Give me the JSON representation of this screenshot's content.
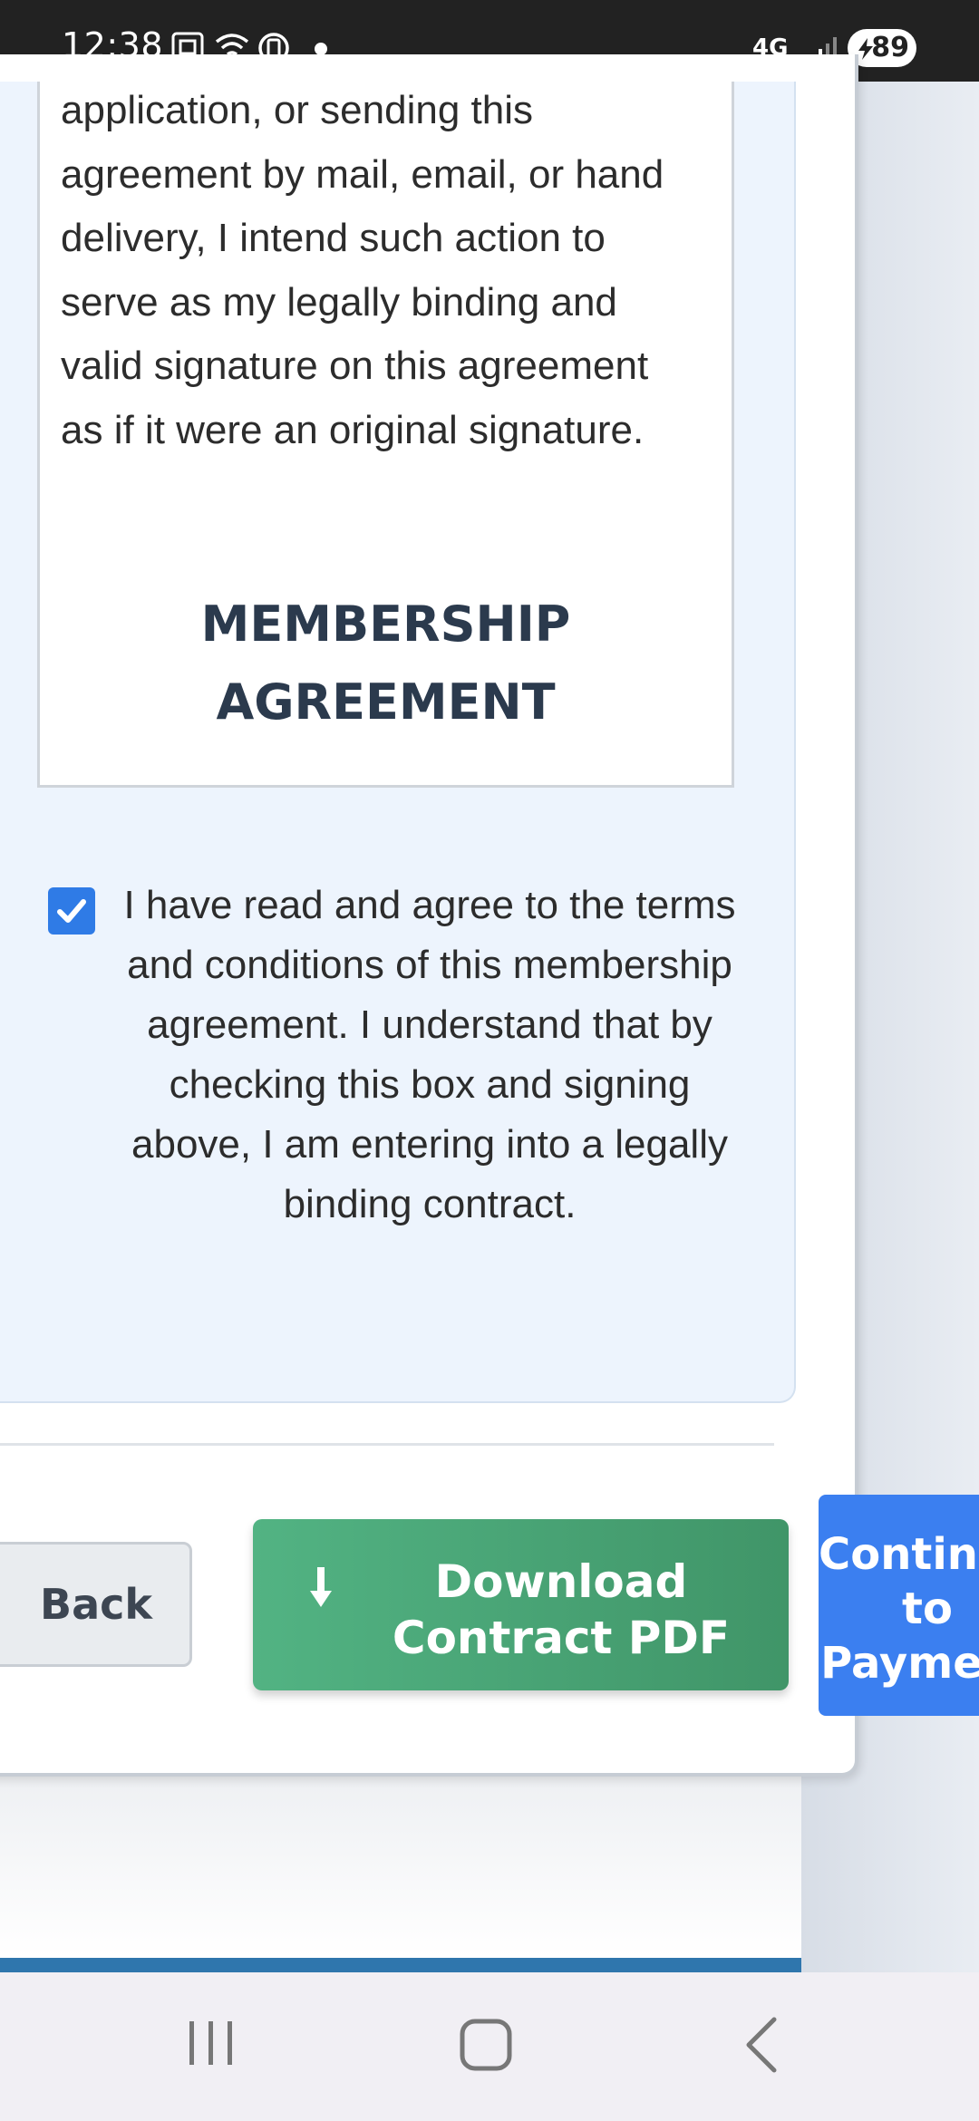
{
  "status_bar": {
    "time": "12:38",
    "network": "4G",
    "battery": "89",
    "icons": [
      "screenshot-icon",
      "wifi-icon",
      "data-saver-icon",
      "notification-dot-icon",
      "signal-icon",
      "battery-icon"
    ]
  },
  "terms": {
    "body_text": "application, or sending this agreement by mail, email, or hand delivery, I intend such action to serve as my legally binding and valid signature on this agreement as if it were an original signature.",
    "heading": "MEMBERSHIP AGREEMENT"
  },
  "agreement": {
    "checked": true,
    "text": "I have read and agree to the terms and conditions of this membership agreement. I understand that by checking this box and signing above, I am entering into a legally binding contract."
  },
  "actions": {
    "back_label": "Back",
    "download_label": "Download Contract PDF",
    "download_icon": "download-arrow-icon",
    "continue_label": "Continue to Payment"
  },
  "colors": {
    "checkbox": "#2f7be6",
    "download_button": "#4aa878",
    "continue_button": "#3b7ff0",
    "heading": "#2b3a4d",
    "terms_panel": "#edf4fd"
  },
  "nav_bar": {
    "buttons": [
      "recent-apps-icon",
      "home-icon",
      "back-icon"
    ]
  }
}
